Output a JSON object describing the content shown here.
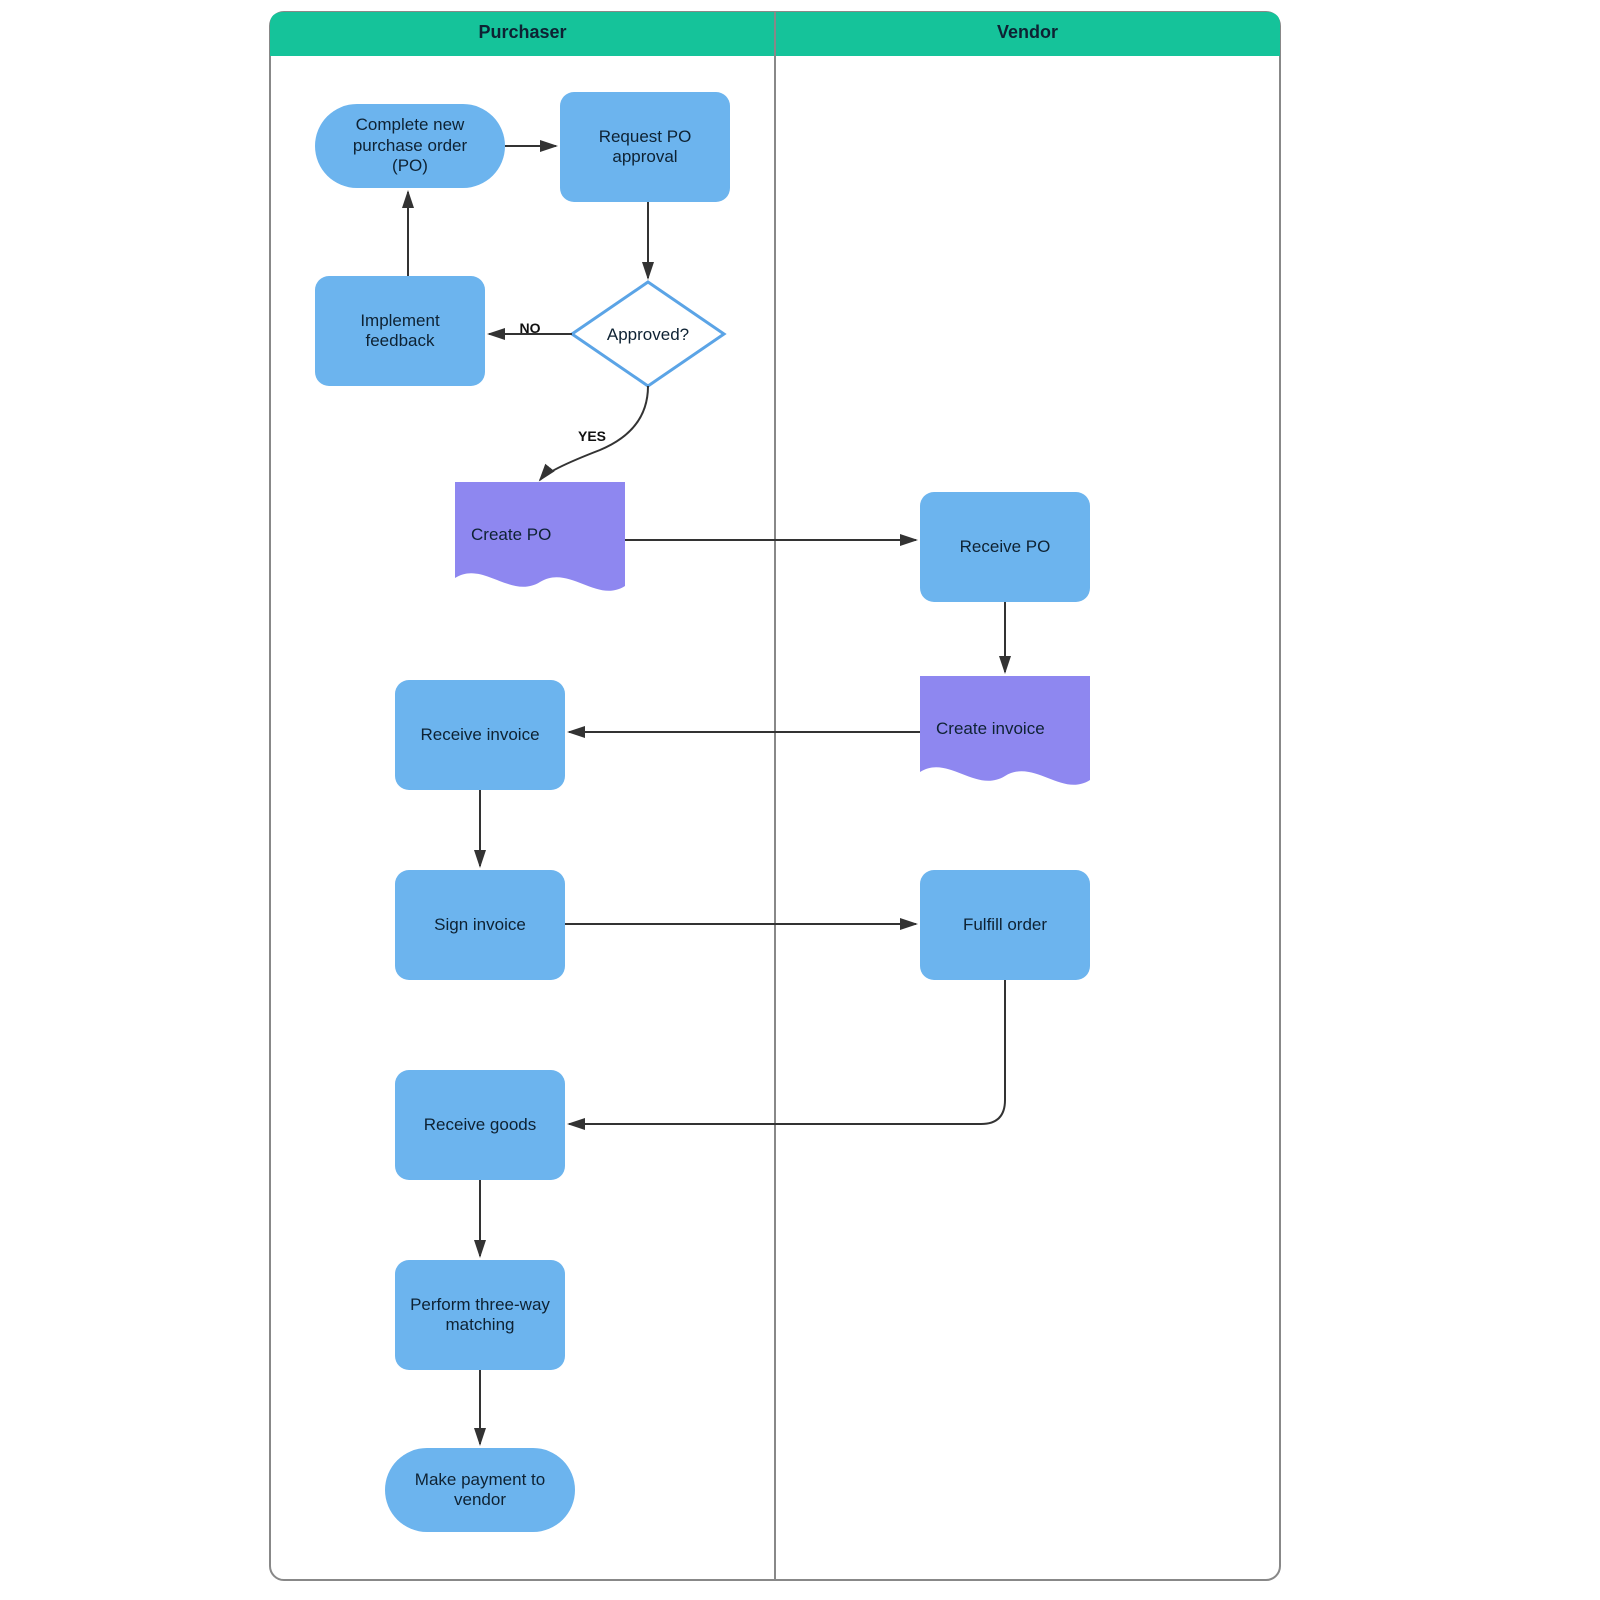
{
  "swimlanes": {
    "purchaser": "Purchaser",
    "vendor": "Vendor"
  },
  "nodes": {
    "complete_po": "Complete new\npurchase order\n(PO)",
    "request_approval": "Request PO\napproval",
    "implement_feedback": "Implement\nfeedback",
    "approved": "Approved?",
    "create_po": "Create PO",
    "receive_po": "Receive PO",
    "create_invoice": "Create invoice",
    "receive_invoice": "Receive invoice",
    "sign_invoice": "Sign invoice",
    "fulfill_order": "Fulfill order",
    "receive_goods": "Receive goods",
    "three_way": "Perform three-way\nmatching",
    "make_payment": "Make payment to\nvendor"
  },
  "edge_labels": {
    "no": "NO",
    "yes": "YES"
  },
  "colors": {
    "lane_header": "#15C39A",
    "lane_border": "#888888",
    "node_blue": "#6CB4EE",
    "node_purple": "#8E87F0",
    "decision_border": "#5BA4E6",
    "arrow": "#333333"
  }
}
